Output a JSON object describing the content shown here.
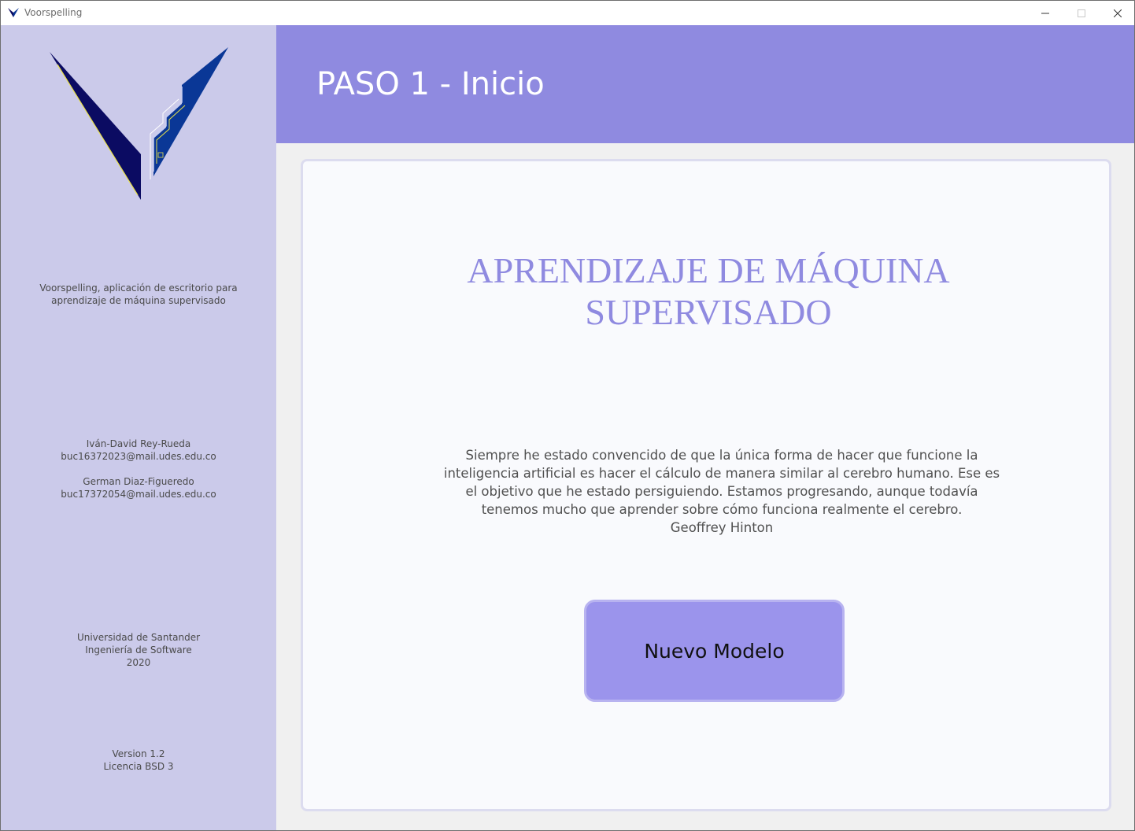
{
  "window": {
    "title": "Voorspelling"
  },
  "colors": {
    "sidebar_bg": "#cbcaea",
    "header_bg": "#8f8ae0",
    "accent": "#8f8ae0",
    "button_bg": "#9b94ec",
    "logo_dark": "#0b0b62",
    "logo_blue": "#0a3796",
    "logo_line": "#e8e04a"
  },
  "icons": {
    "app": "voorspelling-logo-icon",
    "minimize": "minimize-icon",
    "maximize": "maximize-icon",
    "close": "close-icon"
  },
  "sidebar": {
    "description": [
      "Voorspelling, aplicación de escritorio para",
      "aprendizaje de máquina supervisado"
    ],
    "authors": [
      {
        "name": "Iván-David Rey-Rueda",
        "email": "buc16372023@mail.udes.edu.co"
      },
      {
        "name": "German Diaz-Figueredo",
        "email": "buc17372054@mail.udes.edu.co"
      }
    ],
    "institution": [
      "Universidad de Santander",
      "Ingeniería de Software",
      "2020"
    ],
    "version": [
      "Version 1.2",
      "Licencia BSD 3"
    ]
  },
  "header": {
    "title": "PASO 1 - Inicio"
  },
  "main": {
    "title_lines": [
      "APRENDIZAJE DE MÁQUINA",
      "SUPERVISADO"
    ],
    "quote": "Siempre he estado convencido de que la única forma de hacer que funcione la inteligencia artificial es hacer el cálculo de manera similar al cerebro humano. Ese es el objetivo que he estado persiguiendo. Estamos progresando, aunque todavía tenemos mucho que aprender sobre cómo funciona realmente el cerebro.",
    "quote_author": "Geoffrey Hinton",
    "new_model_button": "Nuevo Modelo"
  }
}
